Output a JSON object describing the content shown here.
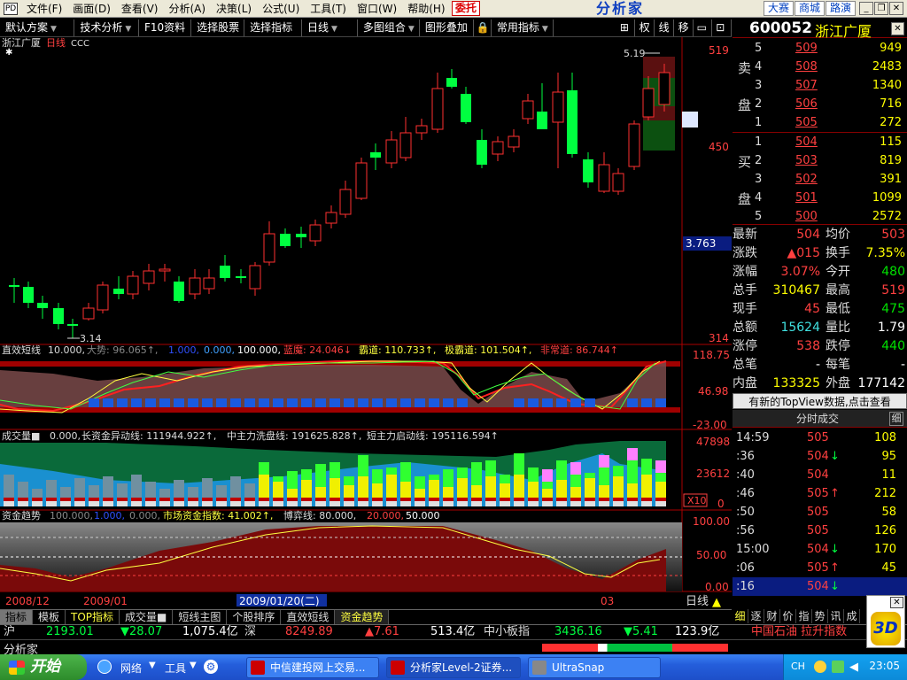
{
  "menubar": {
    "items": [
      "文件(F)",
      "画面(D)",
      "查看(V)",
      "分析(A)",
      "决策(L)",
      "公式(U)",
      "工具(T)",
      "窗口(W)",
      "帮助(H)"
    ],
    "weituo": "委托",
    "brand": "分析家",
    "dasai": "大赛",
    "shangcheng": "商城",
    "lujing": "路演"
  },
  "toolbar": {
    "items": [
      "默认方案",
      "技术分析",
      "F10资料",
      "选择股票",
      "选择指标",
      "日线",
      "多图组合",
      "图形叠加",
      "常用指标"
    ],
    "right": [
      "权",
      "线",
      "移"
    ]
  },
  "chart": {
    "title_name": "浙江广厦",
    "title_period": "日线",
    "title_indicator": "CCC",
    "high_label": "5.19",
    "low_label": "3.14",
    "price_axis": [
      "519",
      "450",
      "314"
    ],
    "cursor_price": "3.763",
    "zhixiao": {
      "header_name": "直效短线",
      "header_val": "10.000,",
      "dashi": "大势: 96.065↑,",
      "v1": "1.000,",
      "v2": "0.000,",
      "v3": "100.000,",
      "lanmo": "蓝魔: 24.046↓",
      "badao": "霸道: 110.733↑,",
      "jibadao": "极霸道: 101.504↑,",
      "feichang": "非常道: 86.744↑",
      "axis": [
        "118.75",
        "46.98",
        "-23.00"
      ]
    },
    "volume": {
      "header_name": "成交量■",
      "v0": "0.000,",
      "long": "长资金异动线: 111944.922↑,",
      "mid": "中主力洗盘线: 191625.828↑,",
      "short": "短主力启动线: 195116.594↑",
      "axis": [
        "47898",
        "23612",
        "0"
      ],
      "x10": "X10"
    },
    "funds": {
      "header_name": "资金趋势",
      "v1": "100.000,",
      "v2": "1.000,",
      "v3": "0.000,",
      "market": "市场资金指数: 41.002↑,",
      "boyi": "博弈线: 80.000,",
      "v4": "20.000,",
      "v5": "50.000",
      "axis": [
        "100.00",
        "50.00",
        "0.00"
      ]
    },
    "dates": [
      "2008/12",
      "2009/01",
      "2009/01/20(二)",
      "03"
    ],
    "period_btn": "日线"
  },
  "stock": {
    "code": "600052",
    "name": "浙江广厦"
  },
  "orderbook": {
    "sell_label": [
      "卖",
      "盘"
    ],
    "buy_label": [
      "买",
      "盘"
    ],
    "sell": [
      {
        "lv": "5",
        "price": "509",
        "vol": "949"
      },
      {
        "lv": "4",
        "price": "508",
        "vol": "2483"
      },
      {
        "lv": "3",
        "price": "507",
        "vol": "1340"
      },
      {
        "lv": "2",
        "price": "506",
        "vol": "716"
      },
      {
        "lv": "1",
        "price": "505",
        "vol": "272"
      }
    ],
    "buy": [
      {
        "lv": "1",
        "price": "504",
        "vol": "115"
      },
      {
        "lv": "2",
        "price": "503",
        "vol": "819"
      },
      {
        "lv": "3",
        "price": "502",
        "vol": "391"
      },
      {
        "lv": "4",
        "price": "501",
        "vol": "1099"
      },
      {
        "lv": "5",
        "price": "500",
        "vol": "2572"
      }
    ]
  },
  "stats": [
    {
      "l1": "最新",
      "v1": "504",
      "l2": "均价",
      "v2": "503"
    },
    {
      "l1": "涨跌",
      "v1": "▲015",
      "l2": "换手",
      "v2": "7.35%"
    },
    {
      "l1": "涨幅",
      "v1": "3.07%",
      "l2": "今开",
      "v2": "480"
    },
    {
      "l1": "总手",
      "v1": "310467",
      "l2": "最高",
      "v2": "519"
    },
    {
      "l1": "现手",
      "v1": "45",
      "l2": "最低",
      "v2": "475"
    },
    {
      "l1": "总额",
      "v1": "15624",
      "l2": "量比",
      "v2": "1.79"
    },
    {
      "l1": "涨停",
      "v1": "538",
      "l2": "跌停",
      "v2": "440"
    },
    {
      "l1": "总笔",
      "v1": "-",
      "l2": "每笔",
      "v2": "-"
    },
    {
      "l1": "内盘",
      "v1": "133325",
      "l2": "外盘",
      "v2": "177142"
    }
  ],
  "topview": "有新的TopView数据,点击查看",
  "fenshi": {
    "title": "分时成交",
    "btn": "细"
  },
  "trades": [
    {
      "t": "14:59",
      "p": "505",
      "arrow": "",
      "v": "108"
    },
    {
      "t": ":36",
      "p": "504",
      "arrow": "↓",
      "v": "95"
    },
    {
      "t": ":40",
      "p": "504",
      "arrow": "",
      "v": "11"
    },
    {
      "t": ":46",
      "p": "505",
      "arrow": "↑",
      "v": "212"
    },
    {
      "t": ":50",
      "p": "505",
      "arrow": "",
      "v": "58"
    },
    {
      "t": ":56",
      "p": "505",
      "arrow": "",
      "v": "126"
    },
    {
      "t": "15:00",
      "p": "504",
      "arrow": "↓",
      "v": "170"
    },
    {
      "t": ":06",
      "p": "505",
      "arrow": "↑",
      "v": "45"
    },
    {
      "t": ":16",
      "p": "504",
      "arrow": "↓",
      "v": ""
    }
  ],
  "bottom_tabs": [
    "指标",
    "模板",
    "TOP指标",
    "成交量■",
    "短线主图",
    "个股排序",
    "直效短线",
    "资金趋势"
  ],
  "right_tabs": [
    "细",
    "逐",
    "财",
    "价",
    "指",
    "势",
    "讯",
    "成"
  ],
  "ticker": {
    "hu": "沪",
    "hu_val": "2193.01",
    "hu_chg": "▼28.07",
    "hu_amt": "1,075.4亿",
    "shen": "深",
    "shen_val": "8249.89",
    "shen_chg": "▲7.61",
    "shen_amt": "513.4亿",
    "zxb": "中小板指",
    "zxb_val": "3436.16",
    "zxb_chg": "▼5.41",
    "zxb_amt": "123.9亿",
    "news": "中国石油 拉升指数"
  },
  "statusline": "分析家",
  "taskbar": {
    "start": "开始",
    "net": "网络",
    "tools": "工具",
    "tasks": [
      "中信建投网上交易...",
      "分析家Level-2证券...",
      "UltraSnap"
    ],
    "lang": "CH",
    "clock": "23:05"
  },
  "logo3d": "3D",
  "colors": {
    "up": "#ff3030",
    "down": "#00ff40",
    "volume_blue": "#1a6ad6",
    "bg": "#000000"
  }
}
